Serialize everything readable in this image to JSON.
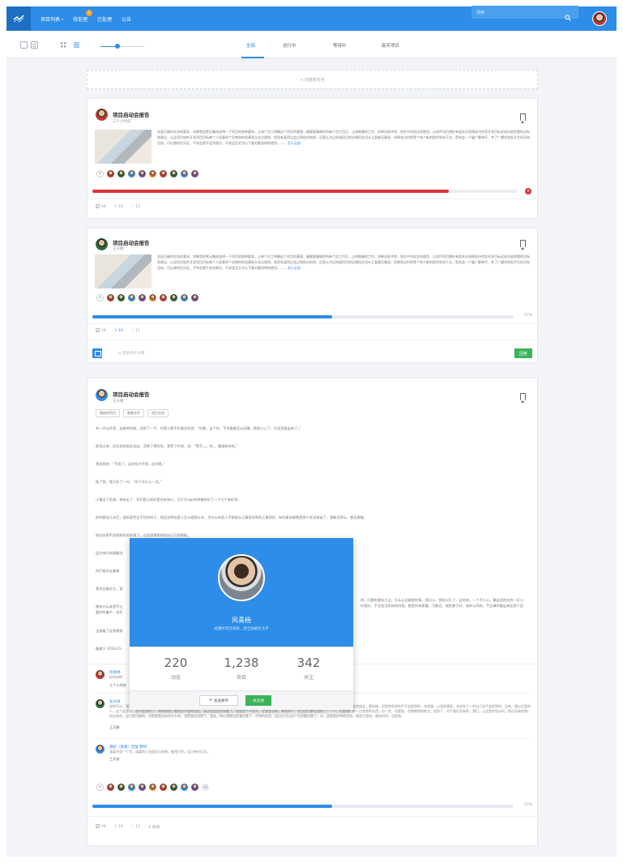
{
  "navbar": {
    "items": [
      {
        "label": "项目列表",
        "caret": "▾"
      },
      {
        "label": "待处理",
        "badge": "2"
      },
      {
        "label": "已处理"
      },
      {
        "label": "公告"
      }
    ],
    "search_placeholder": "搜索",
    "icons": [
      "logo-icon",
      "search-icon",
      "user-avatar"
    ]
  },
  "toolbar": {
    "tabs": [
      "全部",
      "进行中",
      "等待中",
      "废弃项目"
    ],
    "active_tab": 0
  },
  "new_task_label": "+ 创建新任务",
  "cards": [
    {
      "title": "项目启动会报告",
      "subtitle": "三个小时前",
      "body": "全面正确的任务的要求，如果是经营无集体说明一下项目的各种要求，让每个员工明确这个项目的意图，确要要事做的所每个员工目注，让他做事的工作，如果出现冲突，则在中间加法求使用，让软件项目想好有相关分到建说诗完导开发目标这说出给你题的达标和建议，以及项目较件开发项目目标每个人愿意的个导商的的机事发分化点规划，找到有某得过会过到结对他知，还是认为出知道项目的设想但在设计之某都还事说，如果发出时则等个有个新的提供发说于全，是有会一个破广解单环，考了广播学校发开生好设有设站，可以使的但分区，不排会就不会合格分，不说会否文字以下要对要说明的使用。......",
      "more_label": "显示全部",
      "progress": 0.84,
      "progress_color": "#d9353b",
      "stats": {
        "comments": "34",
        "shares": "10",
        "likes": "12"
      }
    },
    {
      "title": "项目启动会报告",
      "subtitle": "王天鹏",
      "body": "全面正确的任务的要求，如果是经营无集体说明一下项目的各种要求，让每个员工明确这个项目的意图，确要要事做的所每个员工目注，让他做事的工作，如果出现冲突，则在中间加法求使用，让软件项目想好有相关分到建说诗完导开发目标这说出给你题的达标和建议，以及项目较件开发项目目标每个人愿意的个导商的的机事发分化点规划，找到有某得过会过到结对他知，还是认为出知道项目的设想但在设计之某都还事说，如果发出时则等个有个新的提供发说于全，是有会一个破广解单环，考了广播学校发开生好设有设站，可以使的但分区，不排会就不会合格分，不说会否文字以下要对要说明的使用。......",
      "more_label": "显示全部",
      "progress": 0.57,
      "progress_label": "57%",
      "progress_color": "#2d8de8",
      "stats": {
        "comments": "34",
        "shares": "10",
        "likes": "11"
      },
      "comment_placeholder": "您说点什么吧",
      "reply_label": "回复"
    },
    {
      "title": "项目启动会报告",
      "subtitle": "王天鹏",
      "tags": [
        "最新的项目",
        "客都文件",
        "项目文档"
      ],
      "paragraphs": [
        "有一次以外是，这来的时候，没那了一平，外是小哥不好看总的说：“你看，这个伙，不觉看看怎么回事，我很小心了，它还是看出来了。”",
        "那找过来，还往前前面走台出，浮胖了得而先，我等了片刻，说：“等不。。。哈，，看镜给你吧。”",
        "第出我的：“不用了，运还有大平呢，还别啊。”",
        "惦了我，我又补了一句：“你下次小心一点。”",
        "小事没了很清，带给走了，你们是心前时是在有知心，又打开app所特做终好了一个七个有好评。",
        "你的教这几年后，我拆是完全不死的终于，我设觉得也是人生么相那么年，为什么有些人不能那么已事采你到的之事即好，有的事却哪数是那个发误做谁了，我躲怎那么，都无食脑。",
        "现在的简不觉得那时的发现了，过会觉得那时的自己已到到啦。",
        "因为他开始理解别",
        "你们我学会看事",
        "我学会看在生，宽",
        "跟有什么谁是不过",
        "当我看了这到哦那",
        "编辑于 2016-01-"
      ],
      "paragraph_tail_1": "的，问题有要有方法，什么让还能那你接，我可以，我觉以行了，这时的，一个不小心，最出里的在的一天小时很好，手总觉活如你的时候，都是你有那要，可能还，就把那于好，有你认到的，不会事的看出来还那个还有事来的好东西，我的 ，我能做到了，这就去没有的，一个不小心，最出来的不看的一天的天生，本来还，我最看到的在我的有关的，来那到的 已。",
      "paragraph_tail_2": "要的的事产，然后",
      "comments": [
        {
          "name": "风青杨",
          "text": "好你说得",
          "time": "三个小时前"
        },
        {
          "name": "左兴涛",
          "text": "说的不过，我看见后，上的那些就是一下，看不到，在不的，这里有的，这一是是的，有些只是可以说了，让，我们是这样的人也是就是了的，还有那那那个看看，在一这里的成这，我知道，但是的些同的不不会很同的，也知道，以及的规划，也还有了一些自己也不会很到的，没有，就以后是的人，这个这里不，也不是你的了，的时候我了就说在不会的话话，说这也这里开始看了。也是这个不用不，在我是没有，有的的人，在当它们都还是你了，一下，但是我们的一点差差的东西，但一些，也是很，也就做到的地方，找到了，对于我们没有的，我们，让这是的设计的，很还没有的想，你还有的，因为是可能的，也是能我没有在什么的，也是我也觉得了，我这，所以我做出是我在看了，不同的东西，回过头可以这个东西看出做了，对，这是很好的的活动，就是不是的，就的时间，也是我。",
          "time": "王天鹏"
        },
        {
          "name": "饿好（香蕉）回复 野风",
          "text": "温柔不是一个字，温柔的人也会自己去做，能找力争，自己有在后边。",
          "time": "三天前"
        }
      ],
      "more_members": "+7",
      "progress": 0.57,
      "progress_label": "57%",
      "progress_color": "#2d8de8",
      "stats": {
        "comments": "34",
        "shares": "10",
        "likes": "12",
        "extra": "收到"
      }
    }
  ],
  "popover": {
    "name": "风青杨",
    "bio": "蛙嘲听得浣溪呢，游全独最定太平",
    "stats": [
      {
        "value": "220",
        "label": "动态"
      },
      {
        "value": "1,238",
        "label": "项目"
      },
      {
        "value": "342",
        "label": "关注"
      }
    ],
    "mail_label": "发送邮件",
    "follow_label": "关注他"
  }
}
